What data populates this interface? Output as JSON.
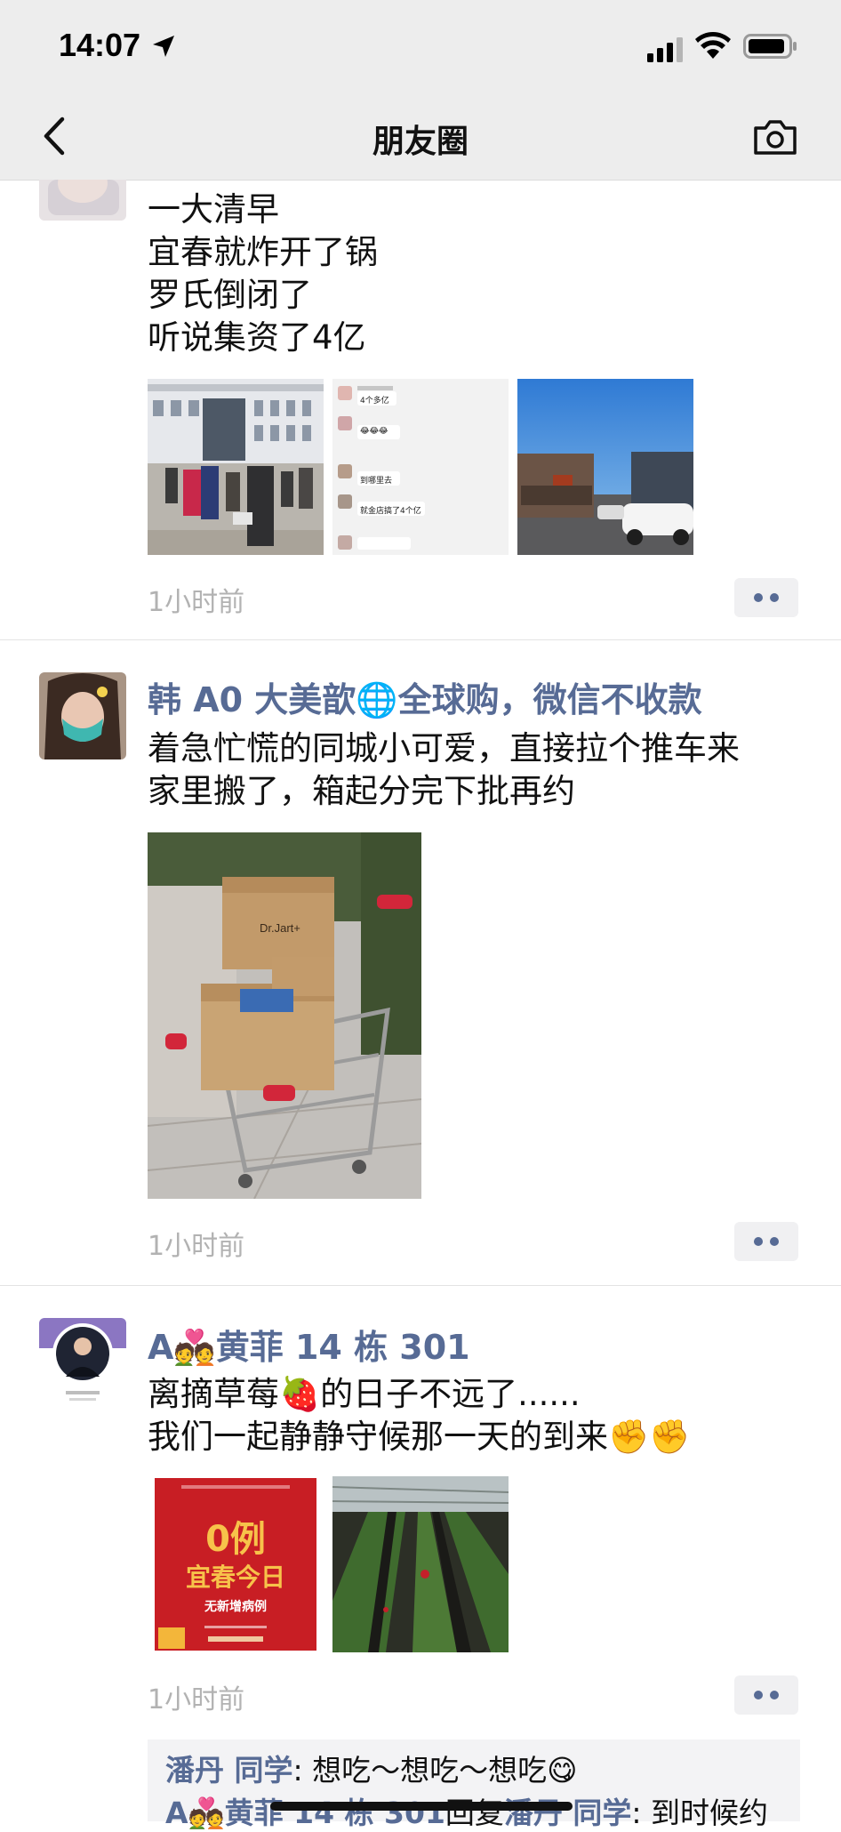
{
  "status": {
    "time": "14:07"
  },
  "nav": {
    "title": "朋友圈"
  },
  "posts": [
    {
      "lines": [
        "一大清早",
        "宜春就炸开了锅",
        "罗氏倒闭了",
        "听说集资了4亿"
      ],
      "chat_snippets": [
        "4个多亿",
        "😂😂😂",
        "到哪里去",
        "就金店搞了4个亿"
      ],
      "time": "1小时前"
    },
    {
      "author": "韩 A0 大美歆🌐全球购，微信不收款",
      "lines": [
        "着急忙慌的同城小可爱，直接拉个推车来",
        "家里搬了，箱起分完下批再约"
      ],
      "box_label": "Dr.Jart+",
      "time": "1小时前"
    },
    {
      "author": "A💑黄菲 14 栋 301",
      "lines": [
        "离摘草莓🍓的日子不远了......",
        "我们一起静静守候那一天的到来✊✊"
      ],
      "poster": {
        "big": "0例",
        "title": "宜春今日",
        "sub": "无新增病例"
      },
      "time": "1小时前",
      "comments": [
        {
          "name": "潘丹 同学",
          "text": ": 想吃～想吃～想吃😋"
        },
        {
          "name": "A💑黄菲 14 栋 301",
          "mid": "回复",
          "name2": "潘丹 同学",
          "text": ": 到时候约"
        }
      ]
    }
  ]
}
